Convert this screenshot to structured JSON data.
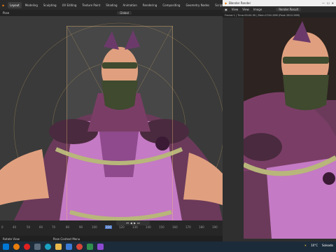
{
  "main_window": {
    "menu_tabs": [
      "Layout",
      "Modeling",
      "Sculpting",
      "UV Editing",
      "Texture Paint",
      "Shading",
      "Animation",
      "Rendering",
      "Compositing",
      "Geometry Nodes",
      "Scripting"
    ],
    "active_tab": "Layout",
    "tool_header": {
      "mode": "Pose",
      "orientation": "Global"
    },
    "timeline": {
      "ruler_labels": [
        "0",
        "40",
        "50",
        "60",
        "70",
        "80",
        "90",
        "100",
        "110",
        "120",
        "130",
        "140",
        "150",
        "160",
        "170",
        "180",
        "190"
      ],
      "current_frame_label": "110"
    },
    "status_bar": {
      "left": "Rotate View",
      "center": "Pose Context Menu"
    }
  },
  "render_window": {
    "title": "Blender Render",
    "menu": [
      "View",
      "View",
      "Image"
    ],
    "slot": "Render Result",
    "info": "Frame:1 | Time:00:04.90 | Mem:2740.28M (Peak 2810.56M)"
  },
  "taskbar": {
    "weather": "10°C",
    "weather_text": "Soleado",
    "colors": {
      "bar": "#1c2b3a",
      "win": "#0078d4"
    }
  },
  "colors": {
    "robe": "#8e4a8c",
    "robe_light": "#c47ac4",
    "cape": "#6b3a5a",
    "rope": "#b8b67a",
    "mask": "#3f4a2e",
    "skin": "#e0a07f"
  }
}
